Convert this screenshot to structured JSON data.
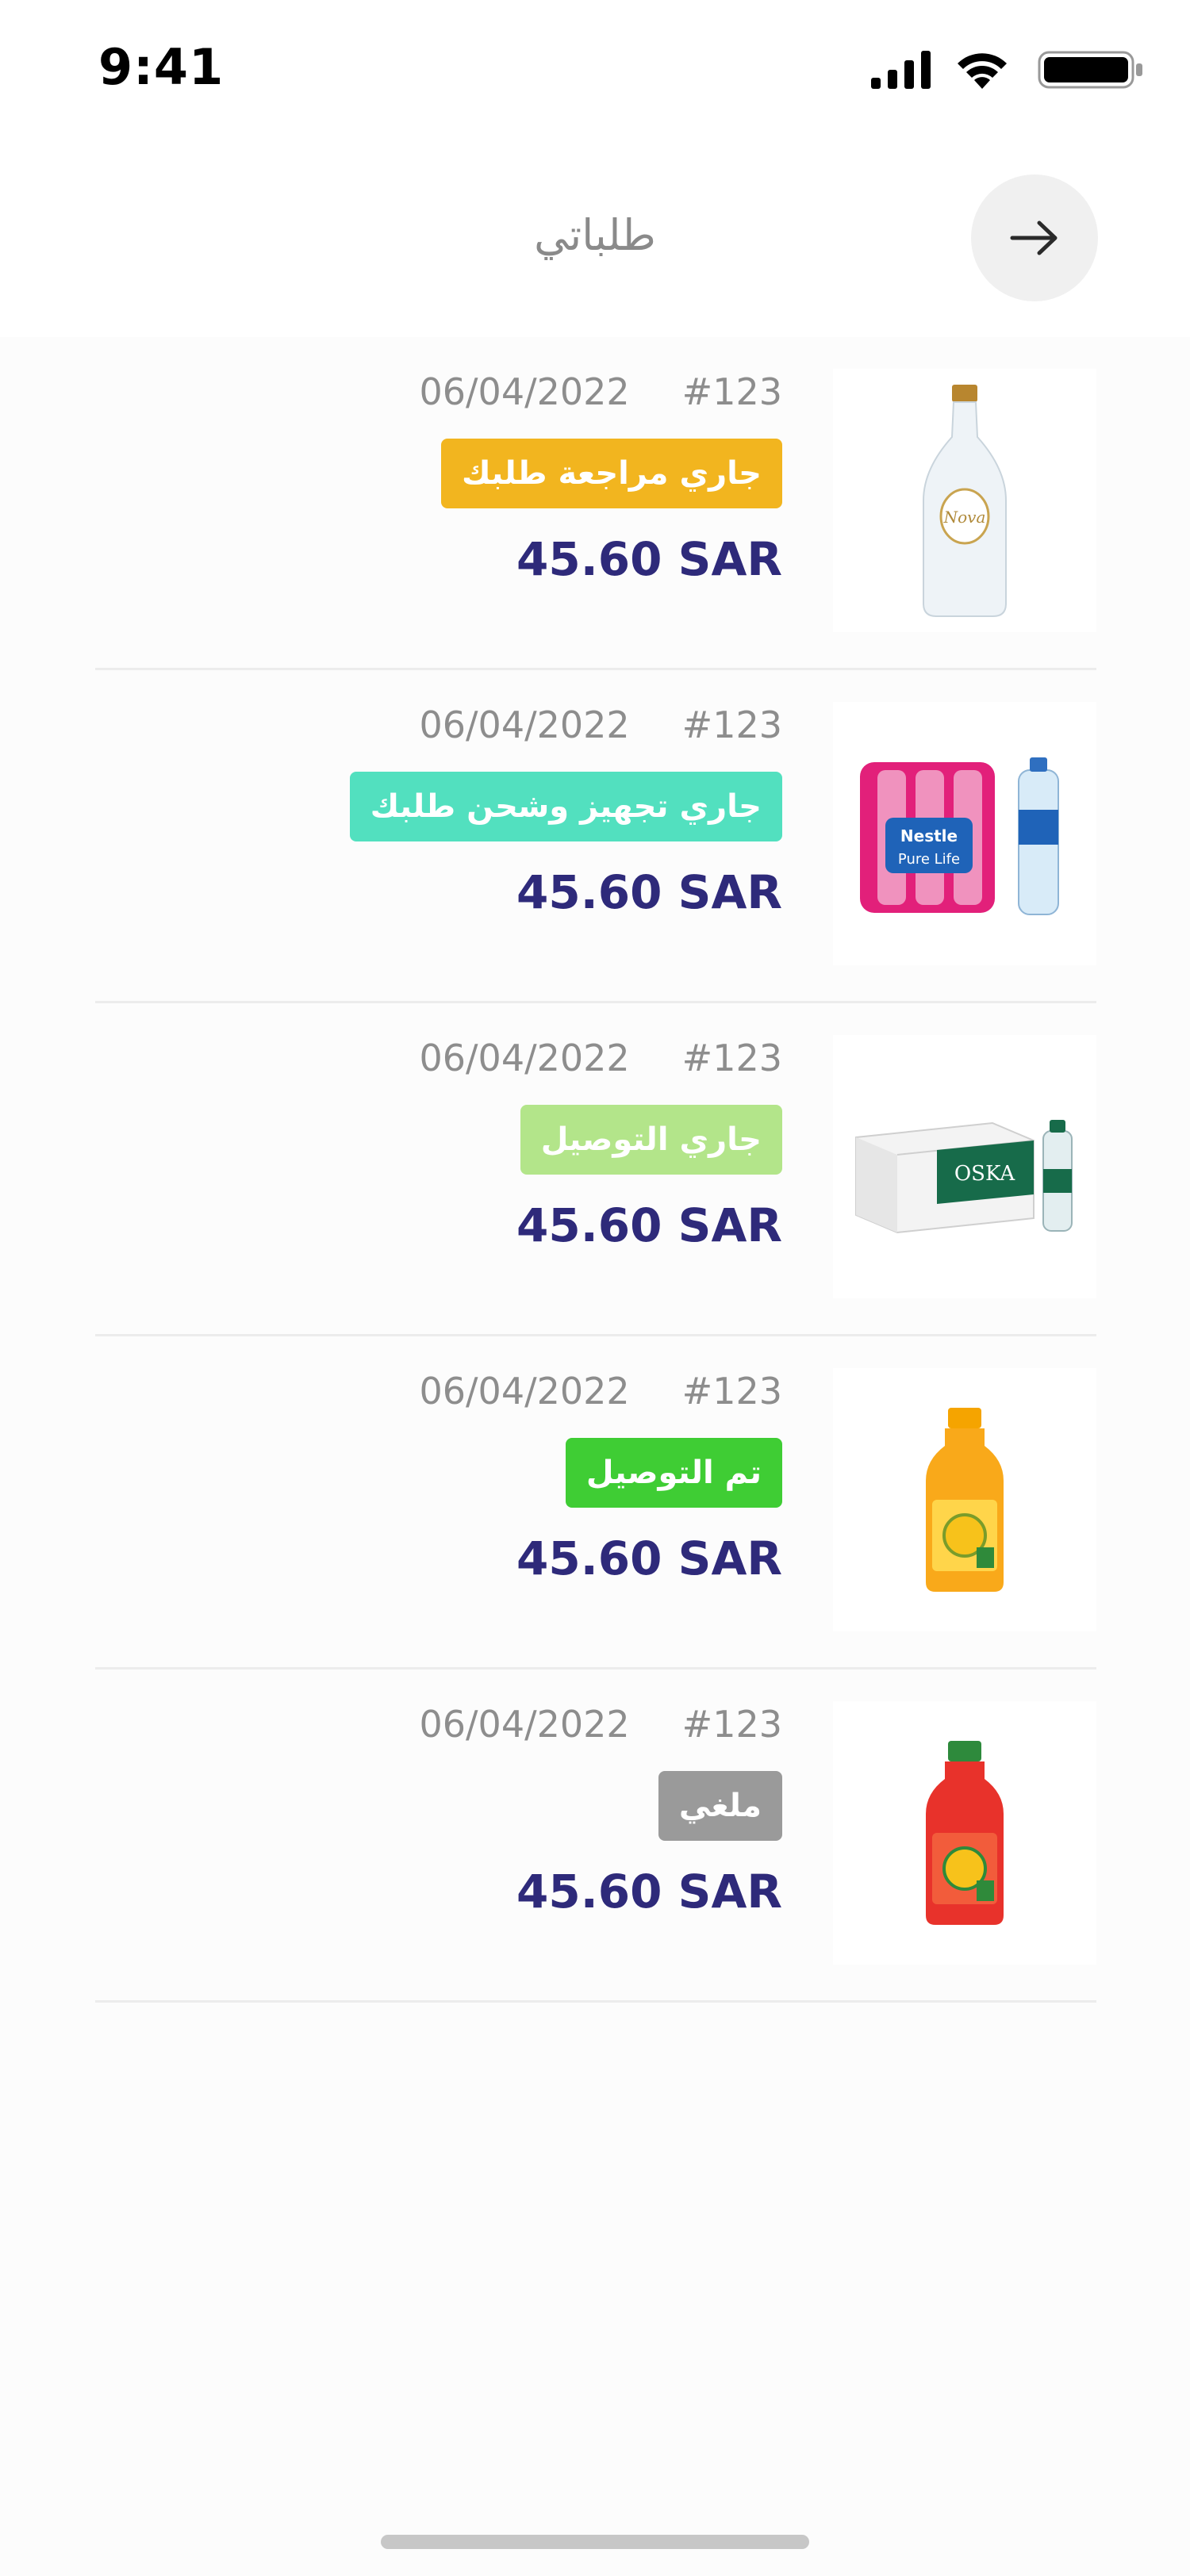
{
  "status_bar": {
    "time": "9:41"
  },
  "header": {
    "title": "طلباتي"
  },
  "orders": [
    {
      "number": "#123",
      "date": "06/04/2022",
      "status": "جاري مراجعة طلبك",
      "status_color": "#f2b51f",
      "price": "45.60 SAR",
      "product_icon": "glass-water-bottle-image"
    },
    {
      "number": "#123",
      "date": "06/04/2022",
      "status": "جاري تجهيز وشحن طلبك",
      "status_color": "#52e0bf",
      "price": "45.60 SAR",
      "product_icon": "water-pack-image"
    },
    {
      "number": "#123",
      "date": "06/04/2022",
      "status": "جاري التوصيل",
      "status_color": "#b3e58a",
      "price": "45.60 SAR",
      "product_icon": "water-carton-image"
    },
    {
      "number": "#123",
      "date": "06/04/2022",
      "status": "تم التوصيل",
      "status_color": "#3fcd34",
      "price": "45.60 SAR",
      "product_icon": "mango-juice-image"
    },
    {
      "number": "#123",
      "date": "06/04/2022",
      "status": "ملغي",
      "status_color": "#9a9a9a",
      "price": "45.60 SAR",
      "product_icon": "mixed-juice-image"
    }
  ]
}
